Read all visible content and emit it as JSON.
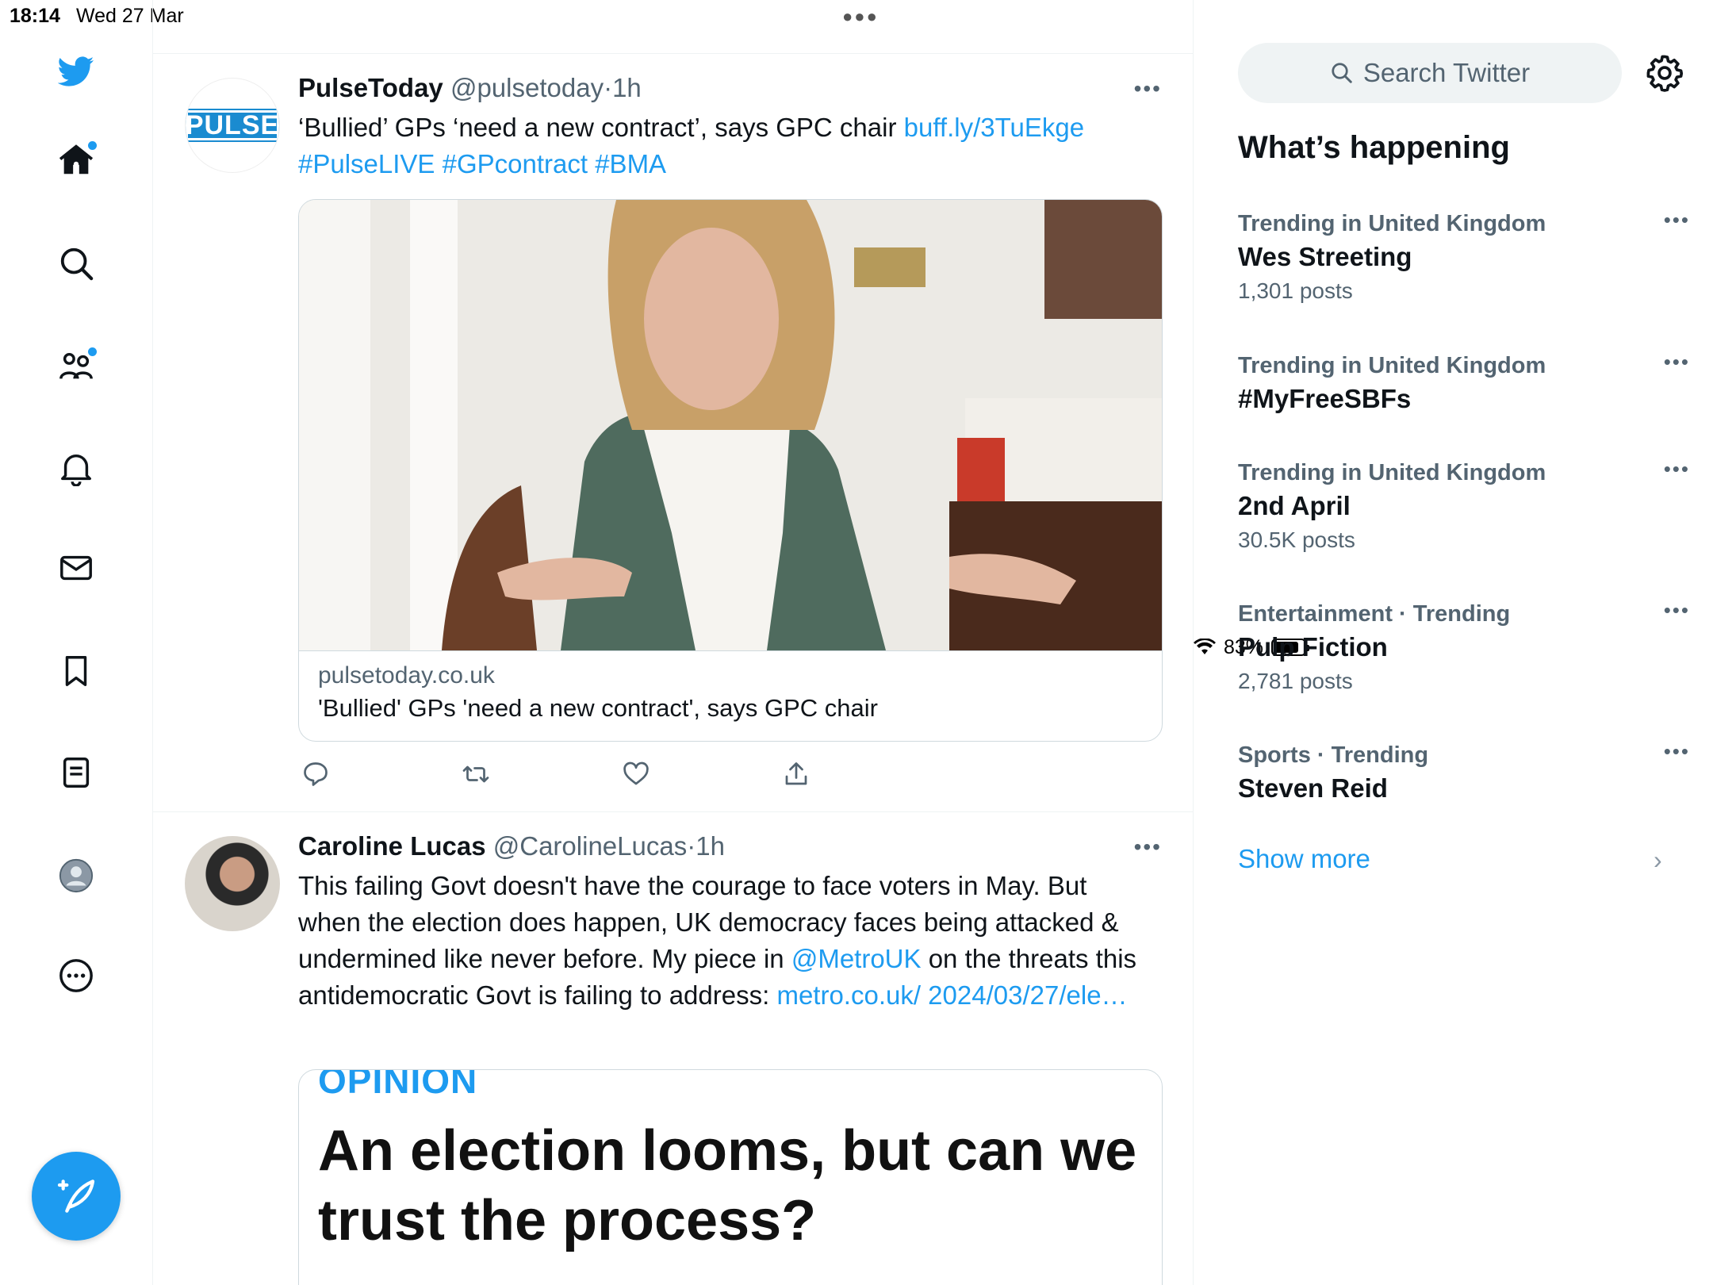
{
  "status_bar": {
    "time": "18:14",
    "date": "Wed 27 Mar",
    "battery_percent": "83%",
    "battery_level": 0.83
  },
  "nav": {
    "items": [
      "home-icon",
      "search-icon",
      "communities-icon",
      "notifications-icon",
      "messages-icon",
      "bookmarks-icon",
      "lists-icon",
      "profile-icon",
      "more-icon"
    ],
    "compose_icon": "compose-icon"
  },
  "tweets": [
    {
      "name": "PulseToday",
      "handle": "@pulsetoday",
      "sep": "·",
      "ago": "1h",
      "avatar_text": "PULSE",
      "text_main": "‘Bullied’ GPs ‘need a new contract’, says GPC chair",
      "link": "buff.ly/3TuEkge",
      "hashtags": "#PulseLIVE #GPcontract #BMA",
      "card": {
        "domain": "pulsetoday.co.uk",
        "title": "'Bullied' GPs 'need a new contract', says GPC chair"
      }
    },
    {
      "name": "Caroline Lucas",
      "handle": "@CarolineLucas",
      "sep": "·",
      "ago": "1h",
      "text_part1": "This failing Govt doesn't have the courage to face voters in May. But when the election does happen, UK democracy faces being attacked & undermined like never before. My piece in ",
      "mention": "@MetroUK",
      "text_part2": " on the threats this antidemocratic Govt is failing to address: ",
      "link": "metro.co.uk/ 2024/03/27/ele…",
      "card": {
        "kicker": "OPINION",
        "headline": "An election looms, but can we trust the process?"
      }
    }
  ],
  "sidebar": {
    "search_placeholder": "Search Twitter",
    "title": "What’s happening",
    "trends": [
      {
        "context": "Trending in United Kingdom",
        "topic": "Wes Streeting",
        "count": "1,301 posts"
      },
      {
        "context": "Trending in United Kingdom",
        "topic": "#MyFreeSBFs",
        "count": ""
      },
      {
        "context": "Trending in United Kingdom",
        "topic": "2nd April",
        "count": "30.5K posts"
      },
      {
        "context": "Entertainment · Trending",
        "topic": "Pulp Fiction",
        "count": "2,781 posts"
      },
      {
        "context": "Sports · Trending",
        "topic": "Steven Reid",
        "count": ""
      }
    ],
    "show_more": "Show more"
  },
  "colors": {
    "accent": "#1d9bf0",
    "text": "#0f1419",
    "muted": "#536471",
    "border": "#eff3f4"
  }
}
